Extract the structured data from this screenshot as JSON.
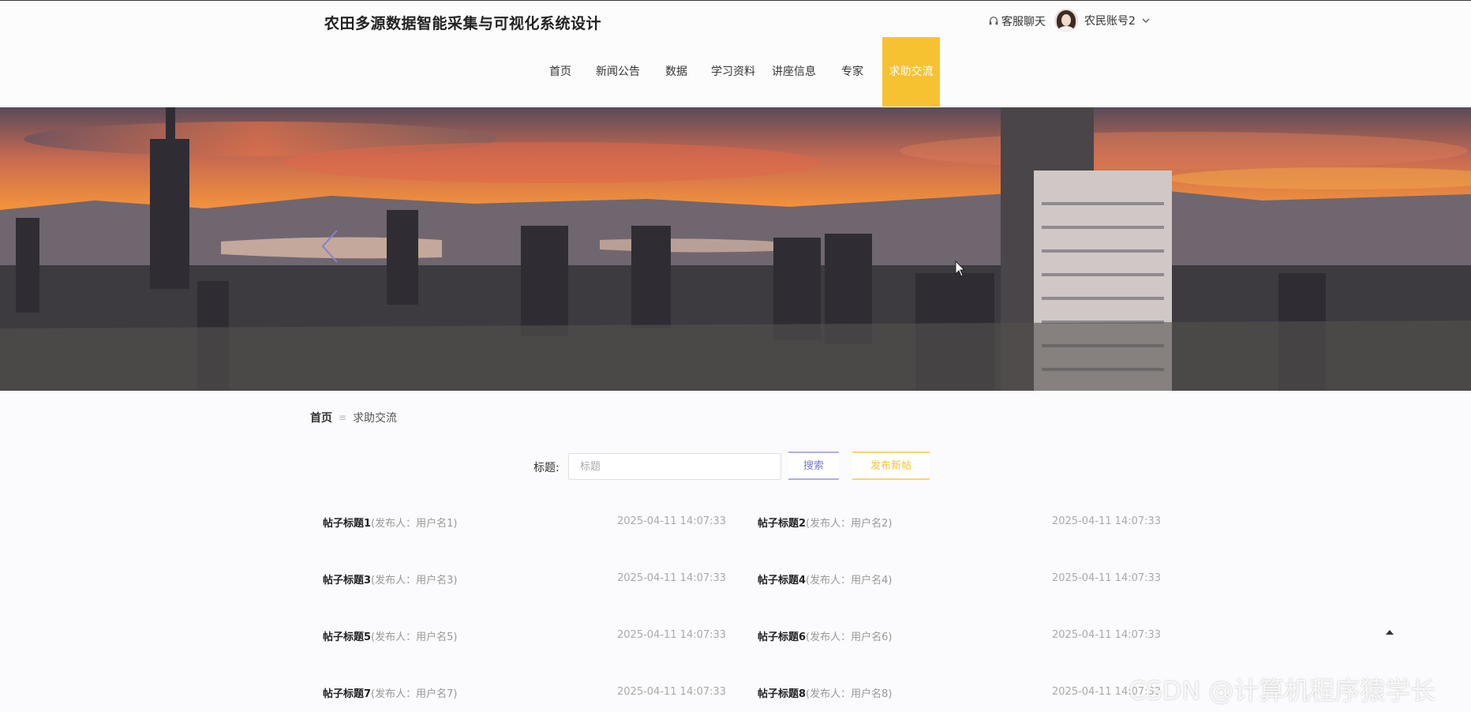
{
  "header": {
    "title": "农田多源数据智能采集与可视化系统设计",
    "service_label": "客服聊天",
    "account_label": "农民账号2"
  },
  "nav": {
    "items": [
      {
        "label": "首页"
      },
      {
        "label": "新闻公告"
      },
      {
        "label": "数据"
      },
      {
        "label": "学习资料"
      },
      {
        "label": "讲座信息"
      },
      {
        "label": "专家"
      },
      {
        "label": "求助交流"
      }
    ],
    "active_index": 6,
    "active_color": "#f7c232"
  },
  "breadcrumb": {
    "home": "首页",
    "separator": "≡",
    "current": "求助交流"
  },
  "search": {
    "label": "标题:",
    "placeholder": "标题",
    "search_button": "搜索",
    "post_button": "发布新帖"
  },
  "posts": [
    {
      "title": "帖子标题1",
      "author": "(发布人：用户名1)",
      "time": "2025-04-11 14:07:33"
    },
    {
      "title": "帖子标题2",
      "author": "(发布人：用户名2)",
      "time": "2025-04-11 14:07:33"
    },
    {
      "title": "帖子标题3",
      "author": "(发布人：用户名3)",
      "time": "2025-04-11 14:07:33"
    },
    {
      "title": "帖子标题4",
      "author": "(发布人：用户名4)",
      "time": "2025-04-11 14:07:33"
    },
    {
      "title": "帖子标题5",
      "author": "(发布人：用户名5)",
      "time": "2025-04-11 14:07:33"
    },
    {
      "title": "帖子标题6",
      "author": "(发布人：用户名6)",
      "time": "2025-04-11 14:07:33"
    },
    {
      "title": "帖子标题7",
      "author": "(发布人：用户名7)",
      "time": "2025-04-11 14:07:33"
    },
    {
      "title": "帖子标题8",
      "author": "(发布人：用户名8)",
      "time": "2025-04-11 14:07:33"
    }
  ],
  "watermark": "CSDN @计算机程序猿学长",
  "icons": {
    "service": "headset-icon",
    "dropdown": "chevron-down-icon",
    "carousel_prev": "chevron-left-icon",
    "back_to_top": "triangle-up-icon"
  }
}
